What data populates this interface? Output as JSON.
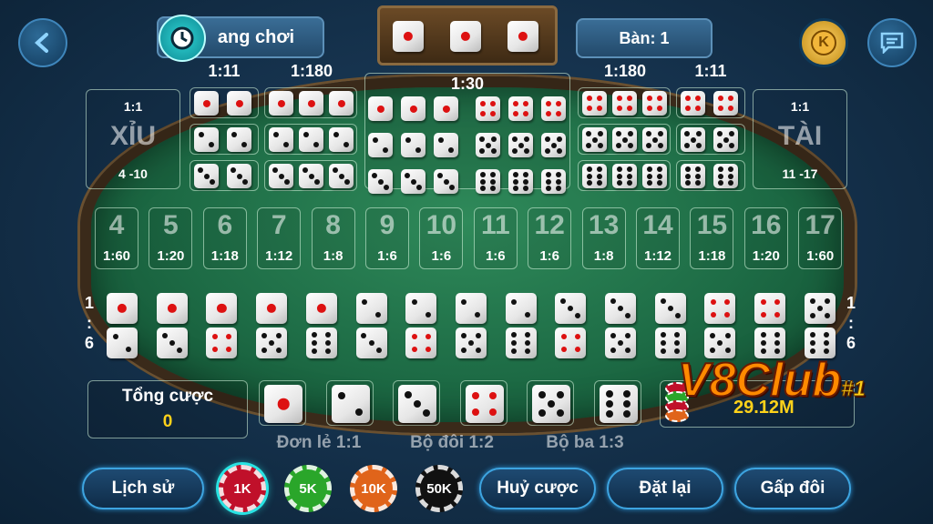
{
  "header": {
    "back_icon": "chevron-left-icon",
    "history_button_label": "ang chơi",
    "history_icon": "clock-history-icon",
    "table_label": "Bàn: 1",
    "coin_icon_letter": "K",
    "chat_icon": "chat-icon",
    "result_dice": [
      1,
      1,
      1
    ]
  },
  "xiu": {
    "ratio": "1:1",
    "title": "XỈU",
    "range": "4 -10"
  },
  "tai": {
    "ratio": "1:1",
    "title": "TÀI",
    "range": "11 -17"
  },
  "pairs_left_ratio": "1:11",
  "triples_left_ratio": "1:180",
  "any_triple_ratio": "1:30",
  "triples_right_ratio": "1:180",
  "pairs_right_ratio": "1:11",
  "totals": [
    {
      "sum": "4",
      "ratio": "1:60"
    },
    {
      "sum": "5",
      "ratio": "1:20"
    },
    {
      "sum": "6",
      "ratio": "1:18"
    },
    {
      "sum": "7",
      "ratio": "1:12"
    },
    {
      "sum": "8",
      "ratio": "1:8"
    },
    {
      "sum": "9",
      "ratio": "1:6"
    },
    {
      "sum": "10",
      "ratio": "1:6"
    },
    {
      "sum": "11",
      "ratio": "1:6"
    },
    {
      "sum": "12",
      "ratio": "1:6"
    },
    {
      "sum": "13",
      "ratio": "1:8"
    },
    {
      "sum": "14",
      "ratio": "1:12"
    },
    {
      "sum": "15",
      "ratio": "1:18"
    },
    {
      "sum": "16",
      "ratio": "1:20"
    },
    {
      "sum": "17",
      "ratio": "1:60"
    }
  ],
  "combo_side_ratio": {
    "left": "1",
    "colon": ":",
    "right": "6"
  },
  "combos": [
    [
      1,
      2
    ],
    [
      1,
      3
    ],
    [
      1,
      4
    ],
    [
      1,
      5
    ],
    [
      1,
      6
    ],
    [
      2,
      3
    ],
    [
      2,
      4
    ],
    [
      2,
      5
    ],
    [
      2,
      6
    ],
    [
      3,
      4
    ],
    [
      3,
      5
    ],
    [
      3,
      6
    ],
    [
      4,
      5
    ],
    [
      4,
      6
    ],
    [
      5,
      6
    ]
  ],
  "total_bet": {
    "label": "Tổng cược",
    "value": "0"
  },
  "singles": [
    1,
    2,
    3,
    4,
    5,
    6
  ],
  "balance": "29.12M",
  "watermark": "V8Club",
  "watermark_badge": "#1",
  "payouts": {
    "single": "Đơn lẻ 1:1",
    "double": "Bộ đôi 1:2",
    "triple": "Bộ ba 1:3"
  },
  "chips": [
    {
      "label": "1K",
      "color": "#c0102a"
    },
    {
      "label": "5K",
      "color": "#2aa62a"
    },
    {
      "label": "10K",
      "color": "#e0641a"
    },
    {
      "label": "50K",
      "color": "#111111"
    }
  ],
  "buttons": {
    "history": "Lịch sử",
    "cancel": "Huỷ cược",
    "reset": "Đặt lại",
    "double": "Gấp đôi"
  }
}
